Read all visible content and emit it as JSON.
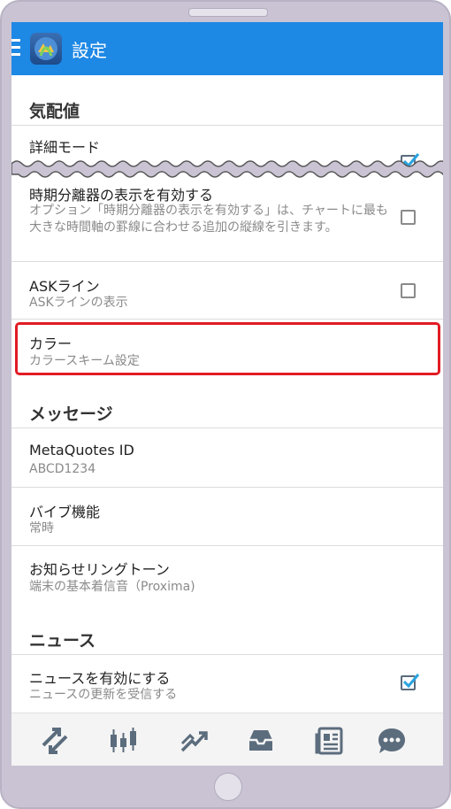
{
  "header": {
    "title": "設定"
  },
  "sections": {
    "quotes": {
      "title": "気配値",
      "detail_mode": {
        "title": "詳細モード",
        "checked": true
      },
      "period_sep": {
        "title": "時期分離器の表示を有効する",
        "desc": "オプション「時期分離器の表示を有効する」は、チャートに最も大きな時間軸の罫線に合わせる追加の縦線を引きます。",
        "checked": false
      },
      "ask_line": {
        "title": "ASKライン",
        "desc": "ASKラインの表示",
        "checked": false
      },
      "color": {
        "title": "カラー",
        "desc": "カラースキーム設定"
      }
    },
    "messages": {
      "title": "メッセージ",
      "metaquotes_id": {
        "title": "MetaQuotes ID",
        "value": "ABCD1234"
      },
      "vibration": {
        "title": "バイブ機能",
        "value": "常時"
      },
      "ringtone": {
        "title": "お知らせリングトーン",
        "value": "端末の基本着信音（Proxima)"
      }
    },
    "news": {
      "title": "ニュース",
      "enable": {
        "title": "ニュースを有効にする",
        "desc": "ニュースの更新を受信する",
        "checked": true
      }
    }
  },
  "bottom_nav": [
    "quotes-arrows-icon",
    "chart-candles-icon",
    "trade-icon",
    "inbox-icon",
    "news-icon",
    "chat-icon"
  ],
  "colors": {
    "accent": "#1e88e5",
    "highlight": "#e21b24",
    "check": "#29a3e0"
  }
}
